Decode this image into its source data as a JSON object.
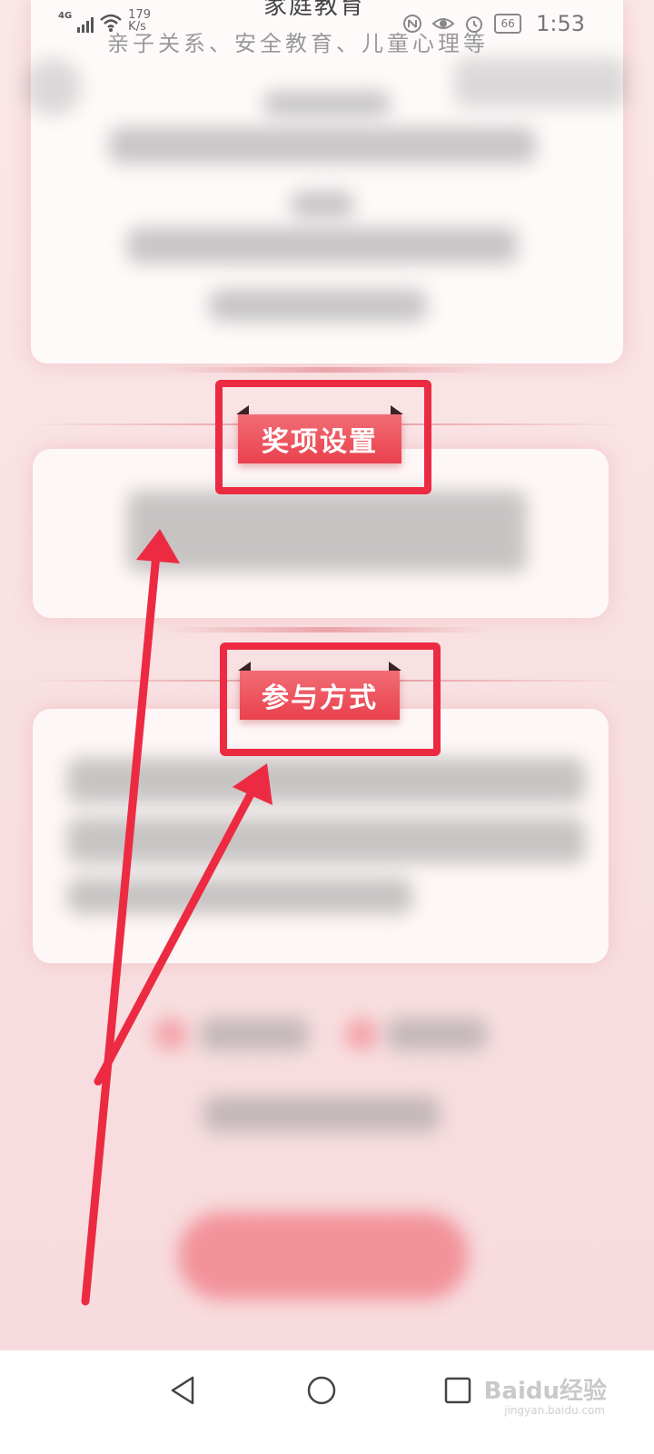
{
  "status_bar": {
    "network": "4G",
    "speed_value": "179",
    "speed_unit": "K/s",
    "battery": "66",
    "time": "1:53"
  },
  "header": {
    "title": "家庭教育",
    "subtitle": "亲子关系、安全教育、儿童心理等"
  },
  "sections": {
    "awards": {
      "label": "奖项设置"
    },
    "participation": {
      "label": "参与方式"
    }
  },
  "watermark": {
    "brand": "Baidu经验",
    "url": "jingyan.baidu.com"
  },
  "colors": {
    "accent": "#ec2b43",
    "ribbon": "#e9414d",
    "background": "#f9e4e5"
  },
  "icons": {
    "back": "triangle-back-icon",
    "home": "circle-home-icon",
    "recents": "square-recents-icon"
  }
}
